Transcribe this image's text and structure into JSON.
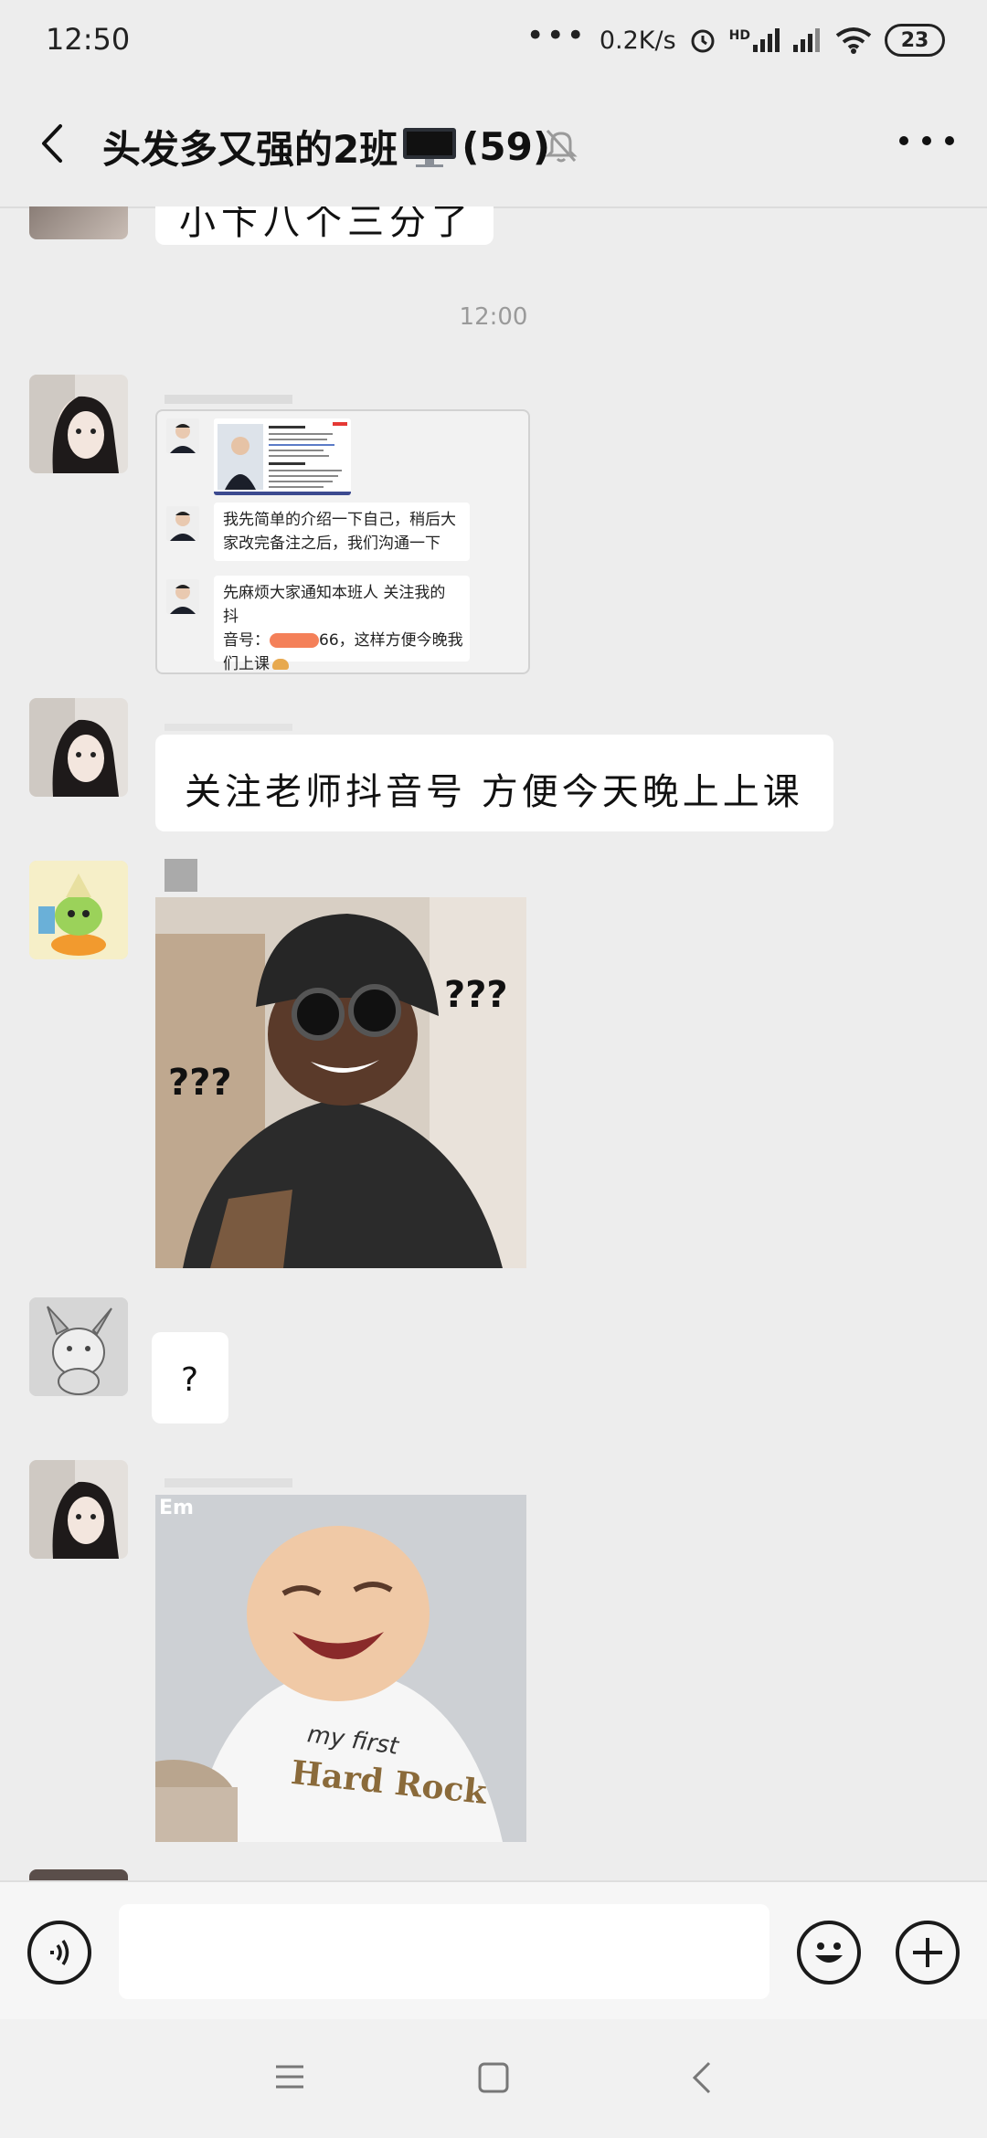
{
  "status_bar": {
    "time": "12:50",
    "dots": "•••",
    "network_speed": "0.2K/s",
    "hd_label": "HD",
    "battery": "23"
  },
  "header": {
    "title_prefix": "头发多又强的2班",
    "member_count": "(59)",
    "icons": [
      "back-icon",
      "monitor-emoji-icon",
      "muted-bell-icon",
      "more-icon"
    ]
  },
  "chat": {
    "partial_message": "小卞八个三分了",
    "timestamp": "12:00",
    "forwarded_card": {
      "line1": "我先简单的介绍一下自己，稍后大",
      "line2": "家改完备注之后，我们沟通一下",
      "line3": "先麻烦大家通知本班人 关注我的抖",
      "line4_a": "音号：",
      "line4_b": "66，这样方便今晚我",
      "line5": "们上课"
    },
    "text_message": "关注老师抖音号 方便今天晚上上课",
    "sticker1": {
      "label_left": "???",
      "label_right": "???"
    },
    "question_message": "?",
    "sticker2": {
      "corner_label": "Em",
      "shirt_text_1": "my first",
      "shirt_text_2": "Hard Rock"
    }
  },
  "composer": {
    "input_value": "",
    "icons": [
      "voice-icon",
      "emoji-icon",
      "plus-icon"
    ]
  },
  "navbar": {
    "icons": [
      "menu-icon",
      "home-icon",
      "back-nav-icon"
    ]
  },
  "colors": {
    "background": "#ededed",
    "bubble": "#ffffff",
    "timestamp": "#9a9a9a",
    "redaction": "#f26a3c"
  }
}
